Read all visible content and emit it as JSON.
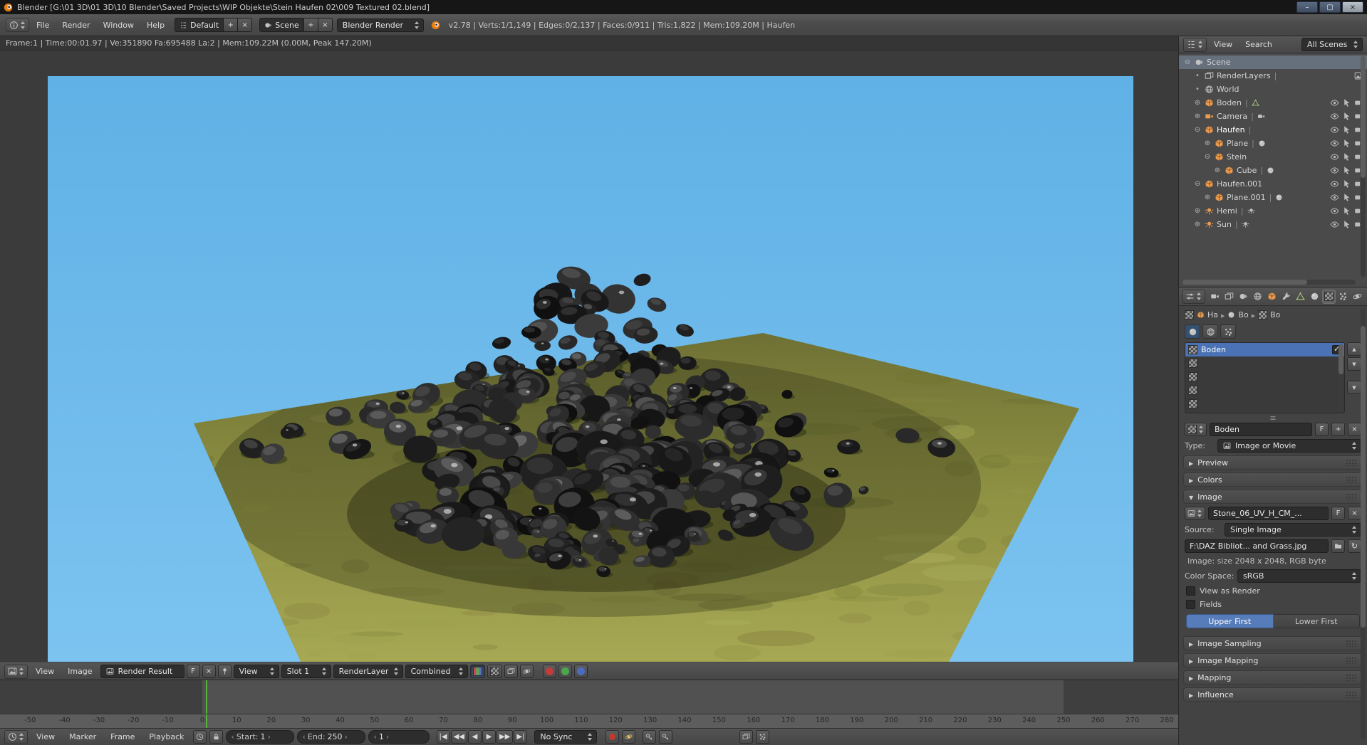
{
  "window": {
    "title": "Blender [G:\\01 3D\\01 3D\\10 Blender\\Saved Projects\\WIP Objekte\\Stein Haufen 02\\009 Textured 02.blend]",
    "minimize": "–",
    "maximize": "▢",
    "close": "×"
  },
  "menubar": {
    "file": "File",
    "render": "Render",
    "window": "Window",
    "help": "Help",
    "layout": "Default",
    "scene": "Scene",
    "engine": "Blender Render",
    "add": "+",
    "remove": "×",
    "stats": "v2.78 | Verts:1/1,149 | Edges:0/2,137 | Faces:0/911 | Tris:1,822 | Mem:109.20M | Haufen"
  },
  "render_info": "Frame:1 | Time:00:01.97 | Ve:351890 Fa:695488 La:2 | Mem:109.22M (0.00M, Peak 147.20M)",
  "viewport": {
    "sky": "#68b8ec",
    "grass_near": "#a6a854",
    "grass_far": "#6e7134",
    "rock": "#1c1c1c"
  },
  "outliner": {
    "view": "View",
    "search": "Search",
    "display": "All Scenes",
    "rows": [
      {
        "label": "Scene"
      },
      {
        "label": "RenderLayers"
      },
      {
        "label": "World"
      },
      {
        "label": "Boden"
      },
      {
        "label": "Camera"
      },
      {
        "label": "Haufen"
      },
      {
        "label": "Plane"
      },
      {
        "label": "Stein"
      },
      {
        "label": "Cube"
      },
      {
        "label": "Haufen.001"
      },
      {
        "label": "Plane.001"
      },
      {
        "label": "Hemi"
      },
      {
        "label": "Sun"
      }
    ]
  },
  "properties": {
    "breadcrumb": {
      "a": "Ha",
      "b": "Bo",
      "c": "Bo"
    },
    "slots": {
      "active": "Boden"
    },
    "name": {
      "value": "Boden",
      "f": "F",
      "add": "+",
      "x": "×"
    },
    "type_label": "Type:",
    "type_value": "Image or Movie",
    "sections": {
      "preview": "Preview",
      "colors": "Colors",
      "image": "Image",
      "sampling": "Image Sampling",
      "image_mapping": "Image Mapping",
      "mapping": "Mapping",
      "influence": "Influence"
    },
    "image": {
      "name": "Stone_06_UV_H_CM_...",
      "f": "F",
      "x": "×",
      "source_label": "Source:",
      "source": "Single Image",
      "path": "F:\\DAZ Bibliot... and Grass.jpg",
      "info": "Image: size 2048 x 2048, RGB byte",
      "cs_label": "Color Space:",
      "cs": "sRGB",
      "view_as_render": "View as Render",
      "fields": "Fields",
      "upper": "Upper First",
      "lower": "Lower First"
    }
  },
  "image_editor": {
    "view": "View",
    "image": "Image",
    "datablock": "Render Result",
    "f": "F",
    "x": "×",
    "mode": "View",
    "slot": "Slot 1",
    "layer": "RenderLayer",
    "pass": "Combined"
  },
  "timeline": {
    "view": "View",
    "marker": "Marker",
    "frame": "Frame",
    "playback": "Playback",
    "start_label": "Start:",
    "start": "1",
    "end_label": "End:",
    "end": "250",
    "current": "1",
    "sync": "No Sync",
    "transport": [
      "|◀",
      "◀◀",
      "◀",
      "▶",
      "▶▶",
      "▶|"
    ],
    "ruler": [
      -50,
      -40,
      -30,
      -20,
      -10,
      0,
      10,
      20,
      30,
      40,
      50,
      60,
      70,
      80,
      90,
      100,
      110,
      120,
      130,
      140,
      150,
      160,
      170,
      180,
      190,
      200,
      210,
      220,
      230,
      240,
      250,
      260,
      270,
      280
    ],
    "frame_start": 0,
    "frame_end": 250,
    "green": "#59b33a"
  }
}
